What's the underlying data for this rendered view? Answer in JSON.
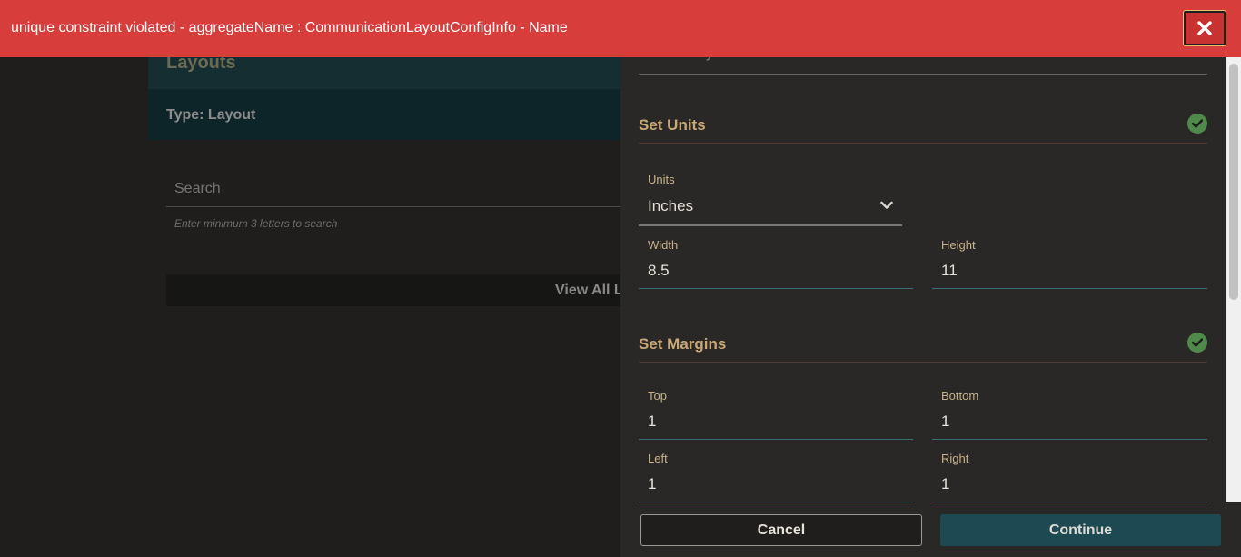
{
  "error_banner": {
    "message": "unique constraint violated - aggregateName : CommunicationLayoutConfigInfo - Name",
    "close_icon": "close-icon",
    "color": "#d73d3b"
  },
  "background_page": {
    "title": "Layouts",
    "type_label": "Type: Layout",
    "search_placeholder": "Search",
    "search_hint": "Enter minimum 3 letters to search",
    "view_all_label": "View All L"
  },
  "panel": {
    "style_classes_placeholder": "Select Style Classes",
    "units_section": {
      "title": "Set Units",
      "status_icon": "check-circle-icon",
      "units_label": "Units",
      "units_value": "Inches",
      "width_label": "Width",
      "width_value": "8.5",
      "height_label": "Height",
      "height_value": "11"
    },
    "margins_section": {
      "title": "Set Margins",
      "status_icon": "check-circle-icon",
      "top_label": "Top",
      "top_value": "1",
      "bottom_label": "Bottom",
      "bottom_value": "1",
      "left_label": "Left",
      "left_value": "1",
      "right_label": "Right",
      "right_value": "1"
    },
    "footer": {
      "cancel_label": "Cancel",
      "continue_label": "Continue"
    }
  },
  "colors": {
    "accent_heading": "#c9a876",
    "success": "#4f8a4a",
    "primary_button": "#1d4a52"
  }
}
